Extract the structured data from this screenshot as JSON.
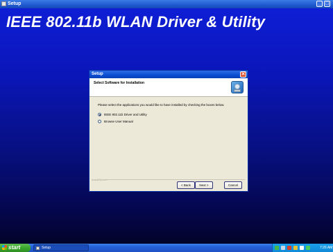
{
  "window": {
    "title": "Setup",
    "minimize_glyph": "_",
    "maximize_glyph": "□"
  },
  "banner": {
    "text": "IEEE 802.11b WLAN Driver & Utility"
  },
  "dialog": {
    "title": "Setup",
    "close_glyph": "✕",
    "header": "Select Software for Installation",
    "header_icon": "setup-disc-icon",
    "instructions": "Please select the applications you would like to have installed by checking the boxes below.",
    "options": [
      {
        "label": "IEEE 802.11b Driver and Utility",
        "selected": true
      },
      {
        "label": "Browse User Manual",
        "selected": false
      }
    ],
    "footer_brand": "InstallShield",
    "buttons": {
      "back": "< Back",
      "next": "Next >",
      "cancel": "Cancel"
    }
  },
  "taskbar": {
    "start_label": "start",
    "tasks": [
      {
        "label": "Setup"
      }
    ],
    "tray_icons": [
      "network-icon",
      "volume-icon",
      "security-icon",
      "wireless-icon",
      "utility-icon",
      "status-icon"
    ],
    "clock": "7:26 AM"
  },
  "colors": {
    "desktop": "#0a16b8",
    "titlebar": "#1f5ad0",
    "dialog_face": "#ece9d8",
    "start_button": "#3aa82e",
    "tray": "#0f8ad8"
  }
}
